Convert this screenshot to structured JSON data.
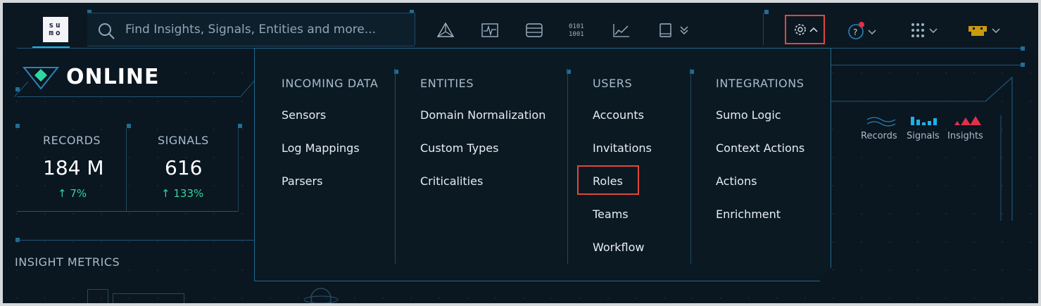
{
  "logo": {
    "text": "su mo"
  },
  "search": {
    "placeholder": "Find Insights, Signals, Entities and more..."
  },
  "nav_icons": [
    "triangle-network-icon",
    "heartbeat-monitor-icon",
    "server-stack-icon",
    "binary-data-icon",
    "area-chart-icon",
    "book-icon"
  ],
  "status": {
    "title": "ONLINE"
  },
  "metrics": [
    {
      "label": "RECORDS",
      "value": "184 M",
      "delta": "7%"
    },
    {
      "label": "SIGNALS",
      "value": "616",
      "delta": "133%"
    }
  ],
  "insight_metrics_label": "INSIGHT METRICS",
  "legend": [
    "Records",
    "Signals",
    "Insights"
  ],
  "colors": {
    "accent": "#1db1e8",
    "highlight_box": "#e0483a",
    "delta": "#2fd7a0",
    "insights_red": "#e0304a"
  },
  "menu": {
    "columns": [
      {
        "title": "INCOMING DATA",
        "items": [
          "Sensors",
          "Log Mappings",
          "Parsers"
        ]
      },
      {
        "title": "ENTITIES",
        "items": [
          "Domain Normalization",
          "Custom Types",
          "Criticalities"
        ]
      },
      {
        "title": "USERS",
        "items": [
          "Accounts",
          "Invitations",
          "Roles",
          "Teams",
          "Workflow"
        ]
      },
      {
        "title": "INTEGRATIONS",
        "items": [
          "Sumo Logic",
          "Context Actions",
          "Actions",
          "Enrichment"
        ]
      }
    ]
  }
}
